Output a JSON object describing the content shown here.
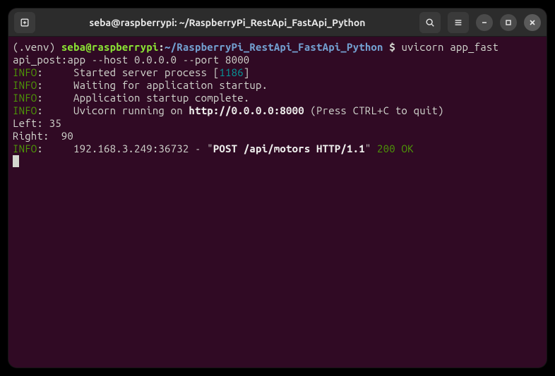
{
  "window": {
    "title": "seba@raspberrypi: ~/RaspberryPi_RestApi_FastApi_Python"
  },
  "prompt": {
    "venv": "(.venv) ",
    "user_host": "seba@raspberrypi",
    "colon": ":",
    "path": "~/RaspberryPi_RestApi_FastApi_Python ",
    "dollar": "$ ",
    "command_part1": "uvicorn app_fast",
    "command_part2": "api_post:app --host 0.0.0.0 --port 8000"
  },
  "lines": {
    "info_label": "INFO",
    "info_colon": ":     ",
    "l1_pre": "Started server process [",
    "l1_pid": "1186",
    "l1_post": "]",
    "l2": "Waiting for application startup.",
    "l3": "Application startup complete.",
    "l4_pre": "Uvicorn running on ",
    "l4_url": "http://0.0.0.0:8000",
    "l4_post": " (Press CTRL+C to quit)",
    "l5": "Left: 35",
    "l6": "Right:  90",
    "l7_ip": "192.168.3.249:36732 - \"",
    "l7_req": "POST /api/motors HTTP/1.1",
    "l7_q": "\" ",
    "l7_status": "200 OK"
  },
  "colors": {
    "background": "#300a24",
    "titlebar": "#2c2c2c",
    "text": "#d3d7cf",
    "green": "#8ae234",
    "blue": "#729fcf",
    "dark_green": "#4e9a06",
    "cyan": "#06989a"
  }
}
